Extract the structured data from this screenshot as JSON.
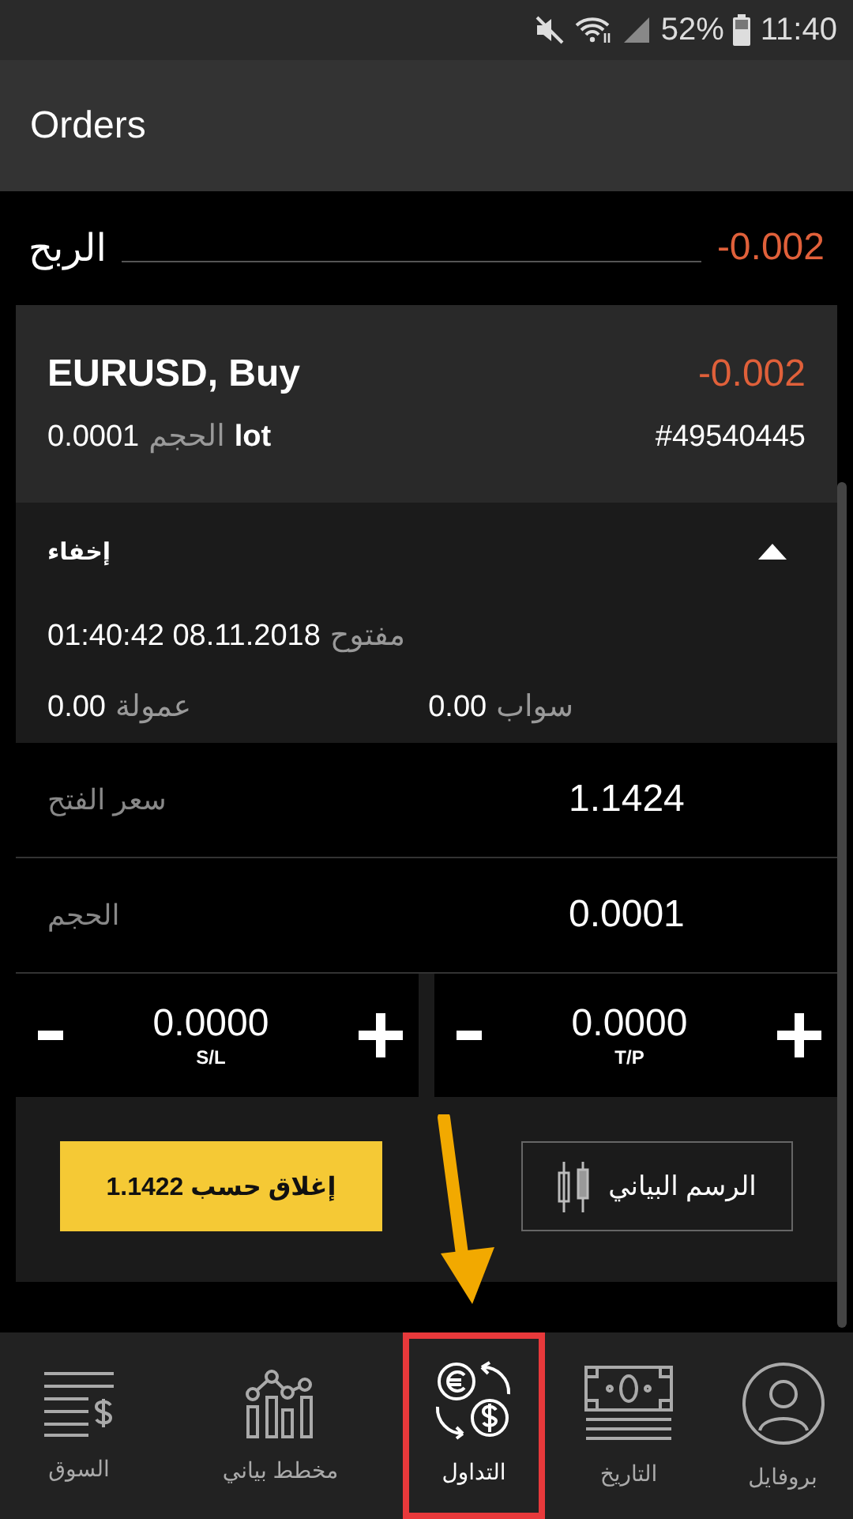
{
  "status_bar": {
    "battery_text": "52%",
    "time": "11:40"
  },
  "app_bar": {
    "title": "Orders"
  },
  "profit": {
    "label": "الربح",
    "value": "-0.002"
  },
  "order": {
    "symbol": "EURUSD, Buy",
    "profit": "-0.002",
    "volume_value": "0.0001",
    "volume_label": "الحجم",
    "volume_unit": "lot",
    "ticket": "#49540445",
    "details": {
      "toggle_label": "إخفاء",
      "expanded": true,
      "open_label": "مفتوح",
      "open_time": "01:40:42 08.11.2018",
      "commission_label": "عمولة",
      "commission_value": "0.00",
      "swap_label": "سواب",
      "swap_value": "0.00"
    },
    "fields": [
      {
        "label": "سعر الفتح",
        "value": "1.1424"
      },
      {
        "label": "الحجم",
        "value": "0.0001"
      }
    ],
    "steppers": [
      {
        "value": "0.0000",
        "caption": "T/P"
      },
      {
        "value": "0.0000",
        "caption": "S/L"
      }
    ],
    "close_button": "إغلاق حسب 1.1422",
    "chart_button": "الرسم البياني"
  },
  "nav": [
    {
      "kind": "profile",
      "label": "بروفايل",
      "selected": false
    },
    {
      "kind": "history",
      "label": "التاريخ",
      "selected": false
    },
    {
      "kind": "trading",
      "label": "التداول",
      "selected": true
    },
    {
      "kind": "chart",
      "label": "مخطط بياني",
      "selected": false
    },
    {
      "kind": "market",
      "label": "السوق",
      "selected": false
    }
  ],
  "annotations": {
    "arrow": true,
    "highlight_box": true
  }
}
